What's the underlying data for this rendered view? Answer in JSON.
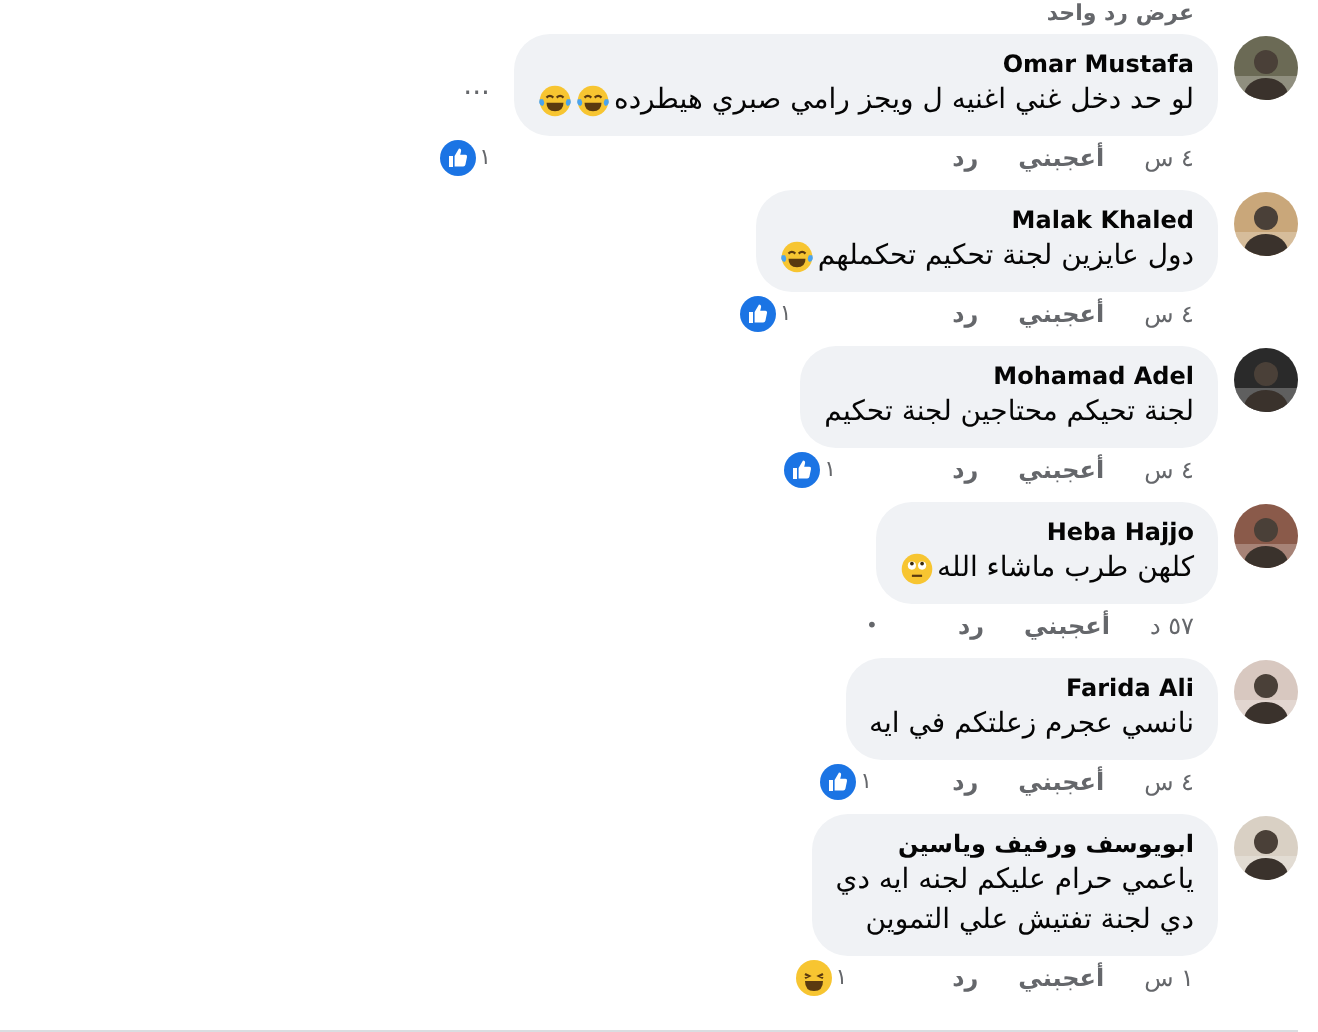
{
  "top_link": "عرض رد واحد",
  "comments": [
    {
      "name": "Omar Mustafa",
      "lines": [
        "لو حد دخل غني اغنيه ل ويجز رامي صبري هيطرده"
      ],
      "emojis": [
        {
          "kind": "joy"
        },
        {
          "kind": "joy"
        }
      ],
      "time": "٤ س",
      "like": "أعجبني",
      "reply": "رد",
      "reaction": {
        "kind": "like",
        "count": "١"
      },
      "menu": "..."
    },
    {
      "name": "Malak Khaled",
      "lines": [
        "دول عايزين لجنة تحكيم تحكملهم"
      ],
      "emojis": [
        {
          "kind": "joy"
        }
      ],
      "time": "٤ س",
      "like": "أعجبني",
      "reply": "رد",
      "reaction": {
        "kind": "like",
        "count": "١"
      }
    },
    {
      "name": "Mohamad Adel",
      "lines": [
        "لجنة تحيكم محتاجين لجنة تحكيم"
      ],
      "time": "٤ س",
      "like": "أعجبني",
      "reply": "رد",
      "reaction": {
        "kind": "like",
        "count": "١"
      }
    },
    {
      "name": "Heba Hajjo",
      "lines": [
        "كلهن طرب ماشاء الله"
      ],
      "emojis": [
        {
          "kind": "eyeroll"
        }
      ],
      "time": "٥٧ د",
      "like": "أعجبني",
      "reply": "رد",
      "trailing": "•"
    },
    {
      "name": "Farida Ali",
      "lines": [
        "نانسي عجرم زعلتكم في ايه"
      ],
      "time": "٤ س",
      "like": "أعجبني",
      "reply": "رد",
      "reaction": {
        "kind": "like",
        "count": "١"
      }
    },
    {
      "name": "ابويوسف ورفيف وياسين",
      "lines": [
        "ياعمي حرام عليكم لجنه ايه دي",
        "دي لجنة تفتيش علي التموين"
      ],
      "time": "١ س",
      "like": "أعجبني",
      "reply": "رد",
      "reaction": {
        "kind": "haha",
        "count": "١"
      }
    }
  ]
}
